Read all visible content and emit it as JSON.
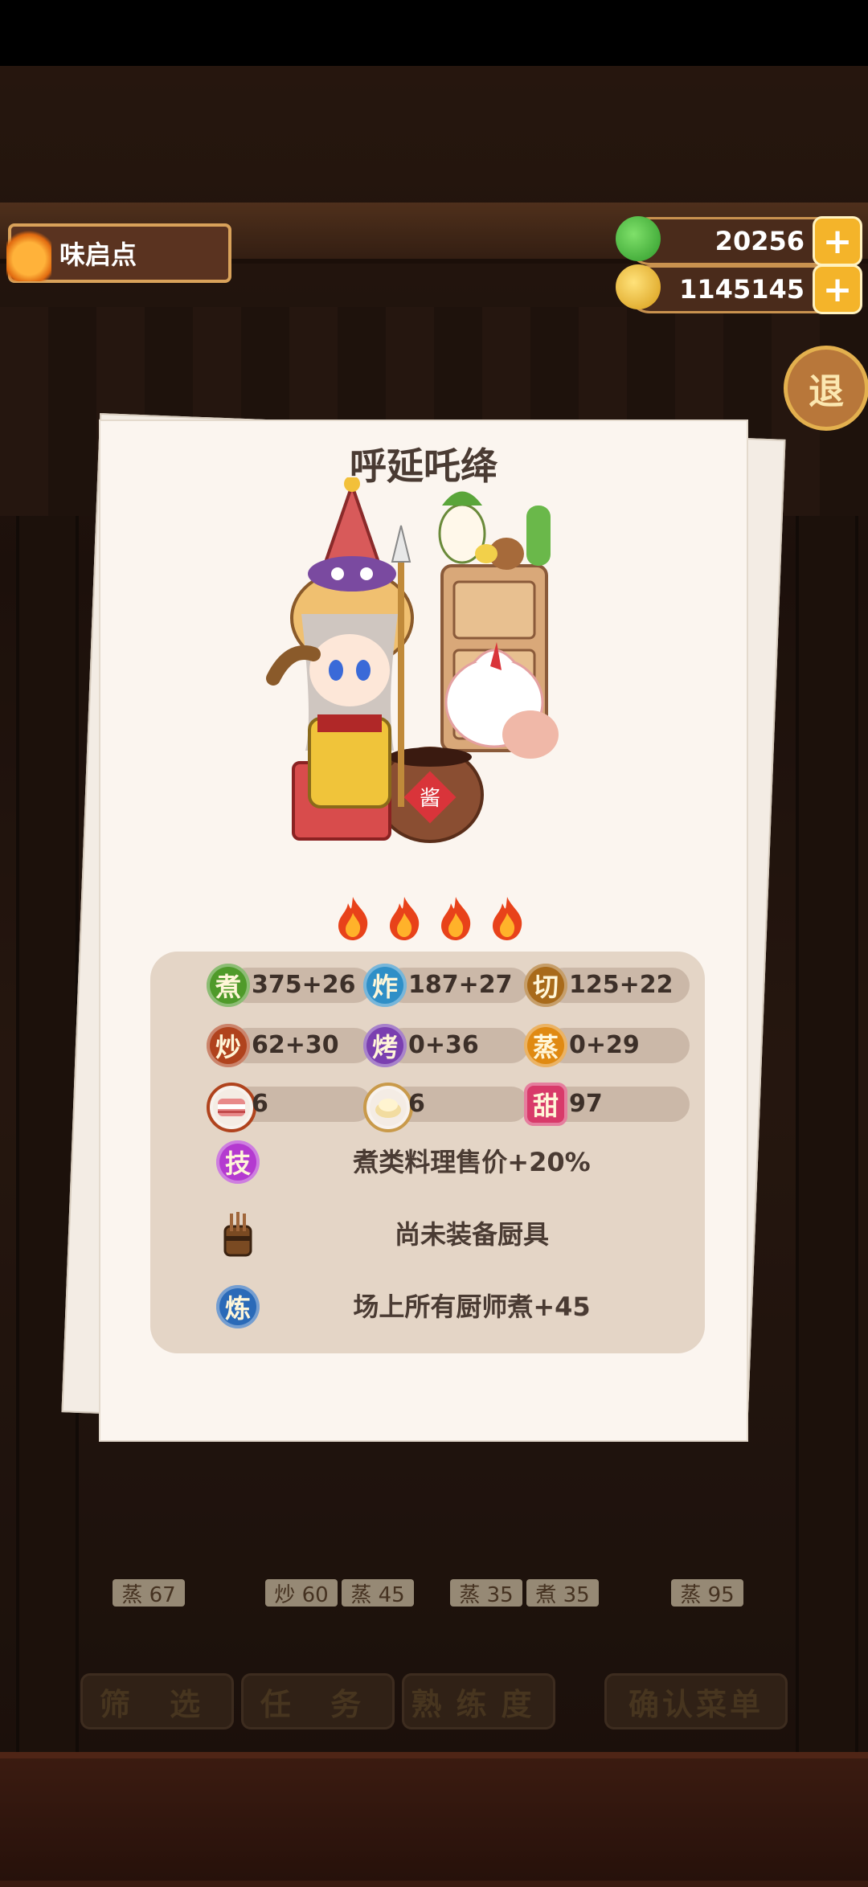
{
  "hud": {
    "location_name": "味启点",
    "currency_green": "20256",
    "currency_coin": "1145145",
    "plus_label": "+",
    "exit_label": "退"
  },
  "chef": {
    "name": "呼延吒绛",
    "rarity_flames": 4,
    "stats": [
      {
        "glyph": "煮",
        "value": "375+26",
        "color": "#4f9a2a"
      },
      {
        "glyph": "炸",
        "value": "187+27",
        "color": "#2f8fc7"
      },
      {
        "glyph": "切",
        "value": "125+22",
        "color": "#a86a1a"
      },
      {
        "glyph": "炒",
        "value": "62+30",
        "color": "#b0431d"
      },
      {
        "glyph": "烤",
        "value": "0+36",
        "color": "#7a3fb0"
      },
      {
        "glyph": "蒸",
        "value": "0+29",
        "color": "#e08a12"
      }
    ],
    "materials": [
      {
        "icon": "meat-icon",
        "value": "6"
      },
      {
        "icon": "flour-icon",
        "value": "6"
      },
      {
        "glyph": "甜",
        "value": "97"
      }
    ],
    "skill_glyph": "技",
    "skill_text": "煮类料理售价+20%",
    "equip_text": "尚未装备厨具",
    "refine_glyph": "炼",
    "refine_text": "场上所有厨师煮+45"
  },
  "background": {
    "bottom_buttons": [
      "筛 选",
      "任 务",
      "熟练度",
      "确认菜单"
    ],
    "dish_labels": [
      "蒸 67",
      "炒 60",
      "蒸 45",
      "蒸 35",
      "煮 35",
      "蒸 95"
    ]
  },
  "colors": {
    "card_bg": "#fbf5ef",
    "stats_bg": "#e4d5c6",
    "accent_gold": "#f4b42a"
  }
}
